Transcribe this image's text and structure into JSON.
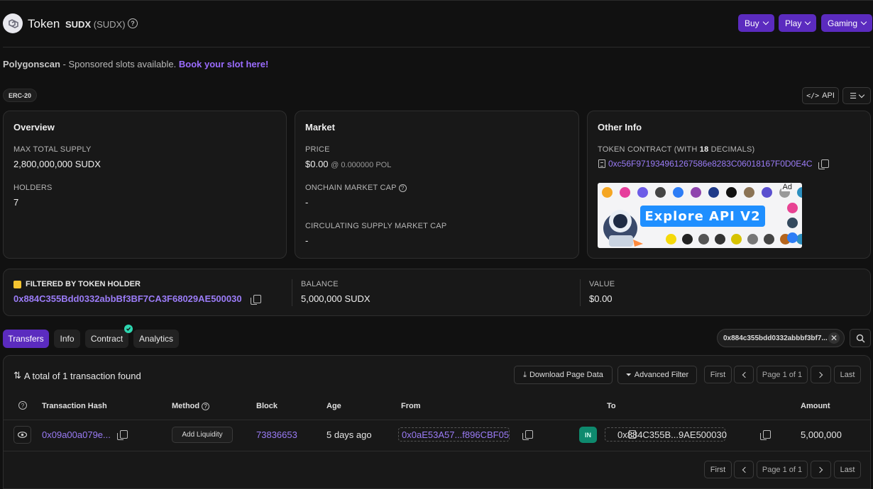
{
  "header": {
    "title": "Token",
    "token_name": "SUDX",
    "token_symbol": "(SUDX)",
    "buttons": [
      {
        "label": "Buy"
      },
      {
        "label": "Play"
      },
      {
        "label": "Gaming"
      }
    ]
  },
  "sponsor": {
    "brand": "Polygonscan",
    "text": " - Sponsored slots available. ",
    "link": "Book your slot here!"
  },
  "badge": "ERC-20",
  "api_button": "API",
  "overview": {
    "heading": "Overview",
    "max_supply_label": "MAX TOTAL SUPPLY",
    "max_supply_value": "2,800,000,000 SUDX",
    "holders_label": "HOLDERS",
    "holders_value": "7"
  },
  "market": {
    "heading": "Market",
    "price_label": "PRICE",
    "price_value": "$0.00",
    "price_pol": "@ 0.000000 POL",
    "onchain_label": "ONCHAIN MARKET CAP",
    "onchain_value": "-",
    "circ_label": "CIRCULATING SUPPLY MARKET CAP",
    "circ_value": "-"
  },
  "other_info": {
    "heading": "Other Info",
    "contract_label_prefix": "TOKEN CONTRACT (WITH ",
    "contract_decimals": "18",
    "contract_label_suffix": " DECIMALS)",
    "contract_address": "0xc56F971934961267586e8283C06018167F0D0E4C",
    "ad_label": "Ad",
    "ad_text": "Explore API V2"
  },
  "filter": {
    "label": "FILTERED BY TOKEN HOLDER",
    "address": "0x884C355Bdd0332abbBf3BF7CA3F68029AE500030",
    "balance_label": "BALANCE",
    "balance_value": "5,000,000 SUDX",
    "value_label": "VALUE",
    "value_value": "$0.00"
  },
  "tabs": [
    {
      "label": "Transfers"
    },
    {
      "label": "Info"
    },
    {
      "label": "Contract"
    },
    {
      "label": "Analytics"
    }
  ],
  "search_chip": "0x884c355bdd0332abbbf3bf7...",
  "table": {
    "summary": "A total of 1 transaction found",
    "download_label": "Download Page Data",
    "advanced_filter_label": "Advanced Filter",
    "pager": {
      "first": "First",
      "page": "Page 1 of 1",
      "last": "Last"
    },
    "columns": {
      "hash": "Transaction Hash",
      "method": "Method",
      "block": "Block",
      "age": "Age",
      "from": "From",
      "to": "To",
      "amount": "Amount"
    },
    "rows": [
      {
        "hash": "0x09a00a079e...",
        "method": "Add Liquidity",
        "block": "73836653",
        "age": "5 days ago",
        "from": "0x0aE53A57...f896CBF05",
        "direction": "IN",
        "to": "0x884C355B...9AE500030",
        "amount": "5,000,000"
      }
    ]
  },
  "colors": {
    "accent": "#5b2bbf",
    "link": "#9b7cf7",
    "in_badge": "#0e8a6e"
  }
}
